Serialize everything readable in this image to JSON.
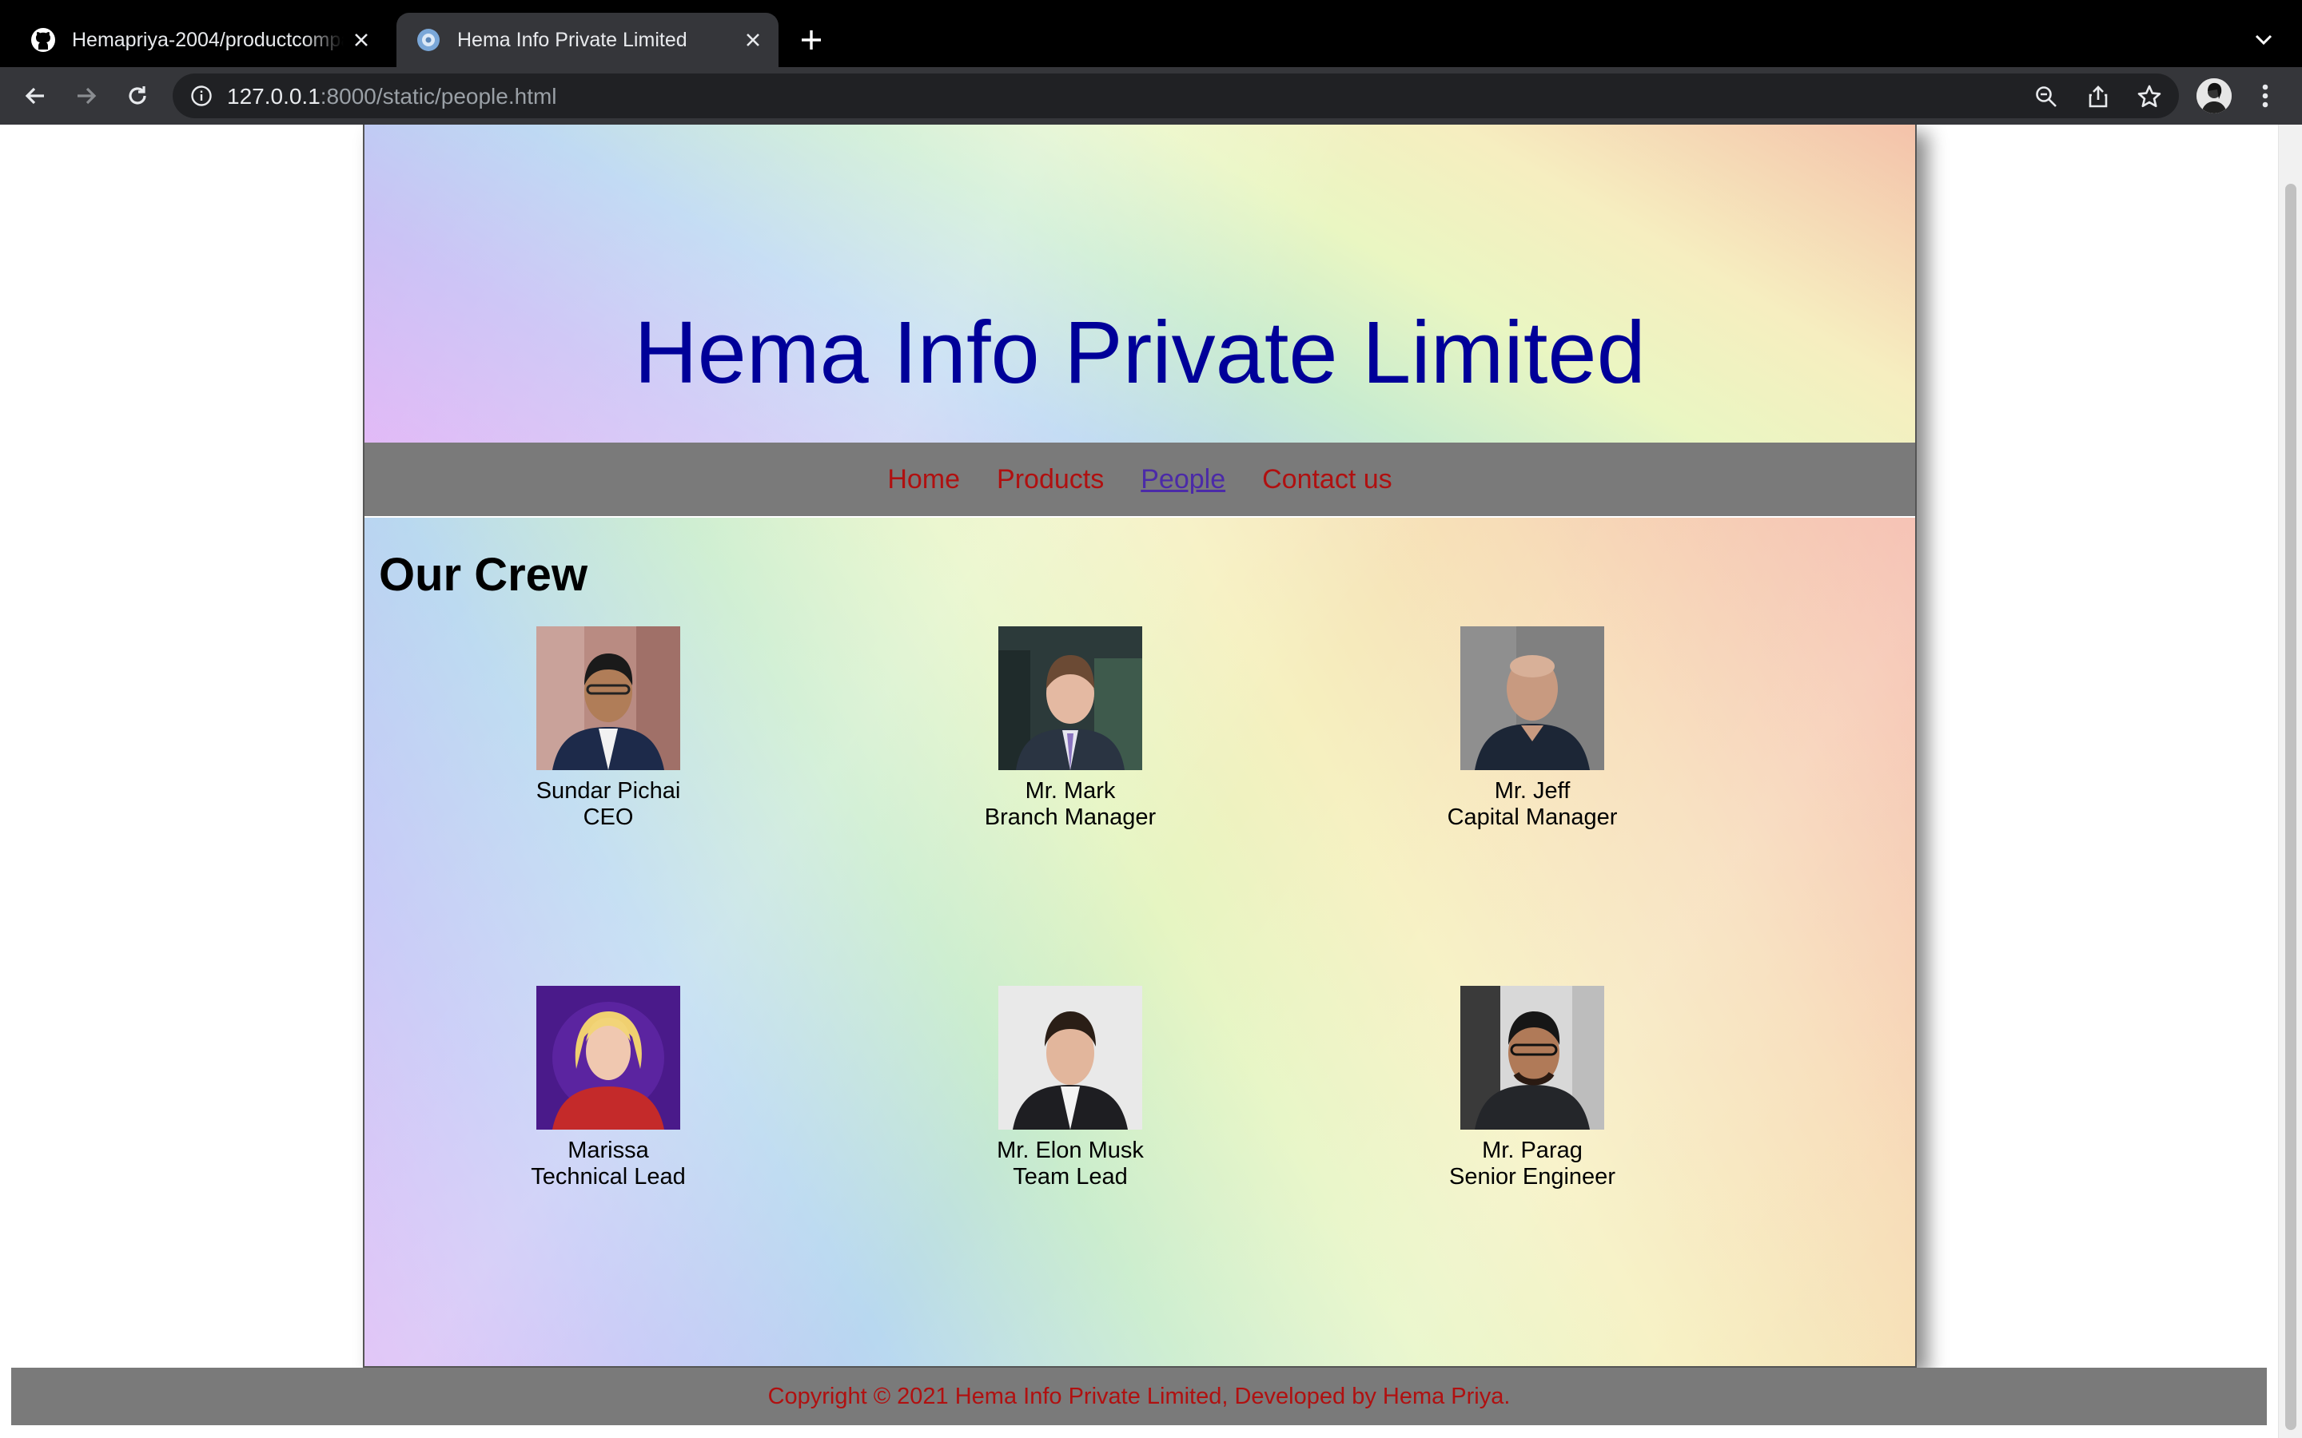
{
  "browser": {
    "tabs": [
      {
        "title": "Hemapriya-2004/productcompany",
        "icon": "github-icon"
      },
      {
        "title": "Hema Info Private Limited",
        "icon": "site-favicon-icon"
      }
    ],
    "url_host": "127.0.0.1",
    "url_path": ":8000/static/people.html"
  },
  "site": {
    "title": "Hema Info Private Limited",
    "nav": [
      "Home",
      "Products",
      "People",
      "Contact us"
    ],
    "active_nav": "People"
  },
  "crew": {
    "heading": "Our Crew",
    "people": [
      {
        "name": "Sundar Pichai",
        "role": "CEO"
      },
      {
        "name": "Mr. Mark",
        "role": "Branch Manager"
      },
      {
        "name": "Mr. Jeff",
        "role": "Capital Manager"
      },
      {
        "name": "Marissa",
        "role": "Technical Lead"
      },
      {
        "name": "Mr. Elon Musk",
        "role": "Team Lead"
      },
      {
        "name": "Mr. Parag",
        "role": "Senior Engineer"
      }
    ]
  },
  "footer": {
    "text": "Copyright © 2021 Hema Info Private Limited, Developed by Hema Priya."
  },
  "colors": {
    "title": "#000099",
    "nav_link": "#b01010",
    "nav_active": "#4b2aa8",
    "bar_bg": "#7a7a7a"
  }
}
